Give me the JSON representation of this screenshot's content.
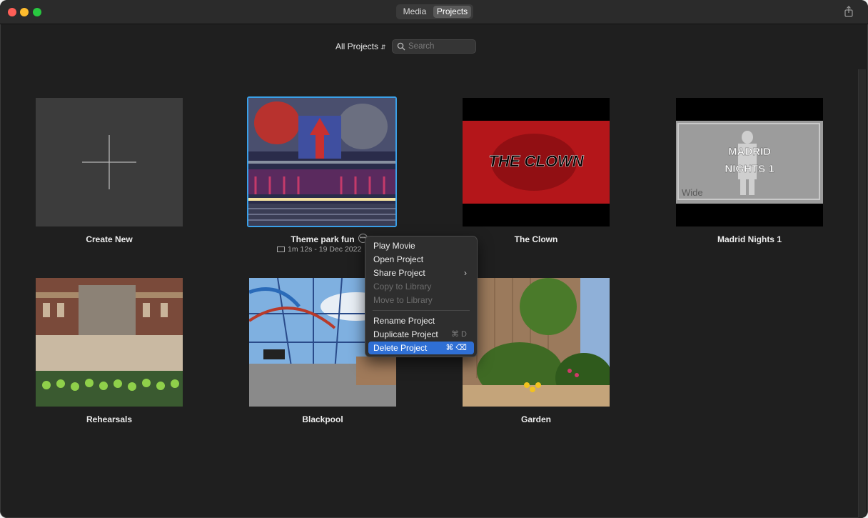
{
  "titlebar": {
    "tabs": [
      {
        "label": "Media",
        "selected": false
      },
      {
        "label": "Projects",
        "selected": true
      }
    ],
    "share_icon": "share-icon"
  },
  "toolbar": {
    "filter_label": "All Projects",
    "filter_chevron": "⌃⌄",
    "search_placeholder": "Search"
  },
  "projects": [
    {
      "title": "Create New",
      "kind": "create"
    },
    {
      "title": "Theme park fun",
      "meta": "1m 12s - 19 Dec 2022",
      "selected": true
    },
    {
      "title": "The Clown",
      "thumb_text": "THE CLOWN"
    },
    {
      "title": "Madrid Nights 1",
      "thumb_text_line1": "MADRID",
      "thumb_text_line2": "NIGHTS 1",
      "thumb_corner": "Wide"
    },
    {
      "title": "Rehearsals"
    },
    {
      "title": "Blackpool"
    },
    {
      "title": "Garden"
    }
  ],
  "context_menu": {
    "items": [
      {
        "label": "Play Movie",
        "enabled": true
      },
      {
        "label": "Open Project",
        "enabled": true
      },
      {
        "label": "Share Project",
        "enabled": true,
        "submenu": "›"
      },
      {
        "label": "Copy to Library",
        "enabled": false
      },
      {
        "label": "Move to Library",
        "enabled": false
      },
      {
        "label": "Rename Project",
        "enabled": true
      },
      {
        "label": "Duplicate Project",
        "enabled": true,
        "shortcut": "⌘ D"
      },
      {
        "label": "Delete Project",
        "enabled": true,
        "shortcut": "⌘ ⌫",
        "highlighted": true
      }
    ]
  },
  "colors": {
    "accent": "#2f6fd4",
    "selection_border": "#3aa0e8",
    "background": "#1f1f1f"
  }
}
